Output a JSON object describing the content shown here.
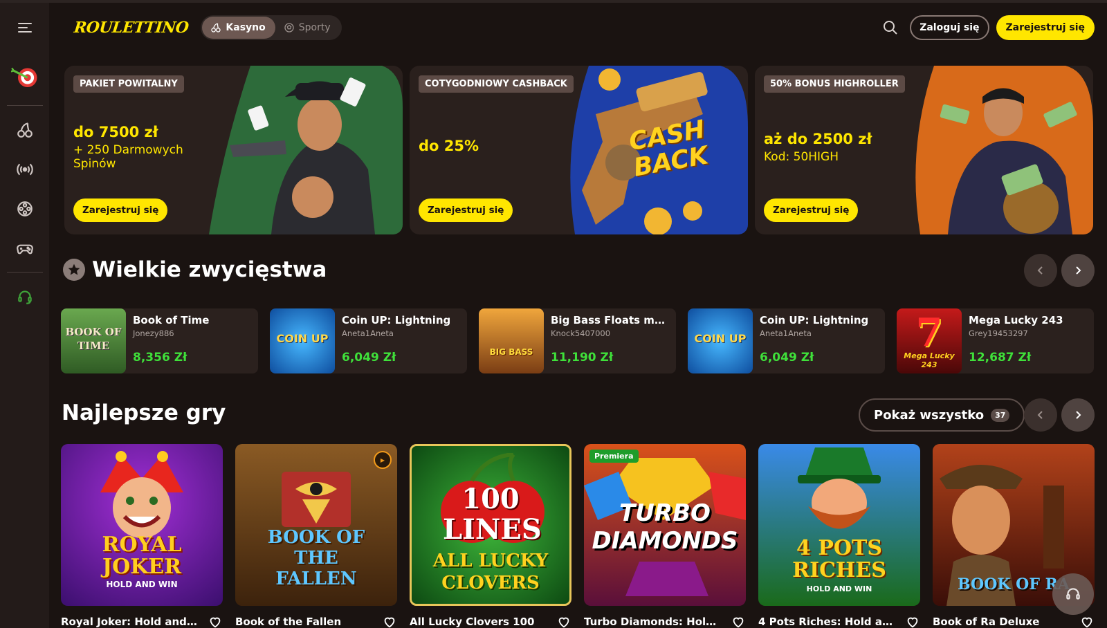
{
  "header": {
    "logo": "ROULETTINO",
    "tabs": [
      {
        "label": "Kasyno",
        "icon": "cherry-icon",
        "active": true
      },
      {
        "label": "Sporty",
        "icon": "soccer-ball-icon",
        "active": false
      }
    ],
    "login_label": "Zaloguj się",
    "register_label": "Zarejestruj się"
  },
  "sidebar": {
    "items": [
      {
        "name": "dart-target-icon"
      },
      {
        "name": "cherry-icon"
      },
      {
        "name": "live-broadcast-icon"
      },
      {
        "name": "film-reel-icon"
      },
      {
        "name": "gamepad-icon"
      },
      {
        "name": "support-headset-icon"
      }
    ]
  },
  "banners": [
    {
      "tag": "PAKIET POWITALNY",
      "title": "do 7500 zł",
      "sub": "+ 250 Darmowych Spinów",
      "button": "Zarejestruj się"
    },
    {
      "tag": "COTYGODNIOWY CASHBACK",
      "title": "do 25%",
      "sub": "",
      "button": "Zarejestruj się",
      "art_text": "CASH BACK"
    },
    {
      "tag": "50% BONUS HIGHROLLER",
      "title": "aż do 2500 zł",
      "sub": "Kod: 50HIGH",
      "button": "Zarejestruj się"
    }
  ],
  "wins": {
    "title": "Wielkie zwycięstwa",
    "items": [
      {
        "game": "Book of Time",
        "user": "Jonezy886",
        "amount": "8,356 Zł",
        "thumb_text": "BOOK OF TIME"
      },
      {
        "game": "Coin UP: Lightning",
        "user": "Aneta1Aneta",
        "amount": "6,049 Zł",
        "thumb_text": "COIN UP"
      },
      {
        "game": "Big Bass Floats my ...",
        "user": "Knock5407000",
        "amount": "11,190 Zł",
        "thumb_text": "BIG BASS"
      },
      {
        "game": "Coin UP: Lightning",
        "user": "Aneta1Aneta",
        "amount": "6,049 Zł",
        "thumb_text": "COIN UP"
      },
      {
        "game": "Mega Lucky 243",
        "user": "Grey19453297",
        "amount": "12,687 Zł",
        "thumb_text": "Mega Lucky 243"
      }
    ]
  },
  "best": {
    "title": "Najlepsze gry",
    "show_all": "Pokaż wszystko",
    "count": "37",
    "games": [
      {
        "name": "Royal Joker: Hold and W...",
        "thumb_text": "ROYAL JOKER",
        "thumb_sub": "HOLD AND WIN"
      },
      {
        "name": "Book of the Fallen",
        "thumb_text": "BOOK OF THE FALLEN",
        "thumb_sub": ""
      },
      {
        "name": "All Lucky Clovers 100",
        "thumb_text": "100 LINES",
        "thumb_sub": "ALL LUCKY CLOVERS"
      },
      {
        "name": "Turbo Diamonds: Hold &...",
        "thumb_text": "TURBO DIAMONDS",
        "thumb_sub": "",
        "badge": "Premiera"
      },
      {
        "name": "4 Pots Riches: Hold and ...",
        "thumb_text": "4 POTS RICHES",
        "thumb_sub": "HOLD AND WIN"
      },
      {
        "name": "Book of Ra Deluxe",
        "thumb_text": "BOOK OF RA",
        "thumb_sub": ""
      }
    ]
  },
  "colors": {
    "accent": "#ffe600",
    "win": "#3fe03a",
    "bg": "#1a1311",
    "card": "#2b211e"
  }
}
